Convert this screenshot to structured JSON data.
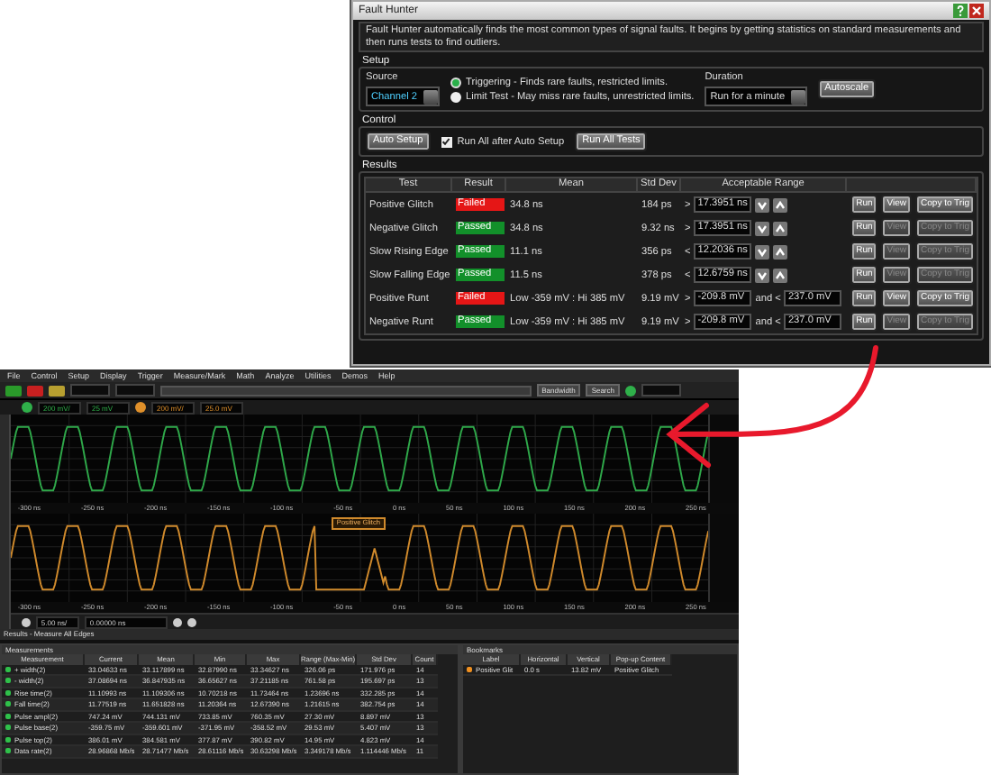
{
  "dialog": {
    "title": "Fault Hunter",
    "description": "Fault Hunter automatically finds the most common types of signal faults. It begins by getting statistics on standard measurements and then runs tests to find outliers.",
    "setup": {
      "title": "Setup",
      "source_label": "Source",
      "source": "Channel 2",
      "modes": [
        {
          "label": "Triggering - Finds rare faults, restricted limits.",
          "selected": true
        },
        {
          "label": "Limit Test - May miss rare faults, unrestricted limits.",
          "selected": false
        }
      ],
      "duration_label": "Duration",
      "duration": "Run for a minute",
      "autoscale": "Autoscale"
    },
    "control": {
      "title": "Control",
      "auto_setup": "Auto Setup",
      "run_all_after": {
        "label": "Run All after Auto Setup",
        "checked": true
      },
      "run_all": "Run All Tests"
    },
    "results": {
      "title": "Results",
      "columns": [
        "Test",
        "Result",
        "Mean",
        "Std Dev",
        "Acceptable Range"
      ],
      "rows": [
        {
          "test": "Positive Glitch",
          "result": "Failed",
          "passed": false,
          "mean": "34.8 ns",
          "std_dev": "184 ps",
          "kind": "threshold",
          "op": ">",
          "limit": "17.3951 ns",
          "run": "Run",
          "view": {
            "label": "View",
            "disabled": false
          },
          "copy": {
            "label": "Copy to Trig",
            "disabled": false
          }
        },
        {
          "test": "Negative Glitch",
          "result": "Passed",
          "passed": true,
          "mean": "34.8 ns",
          "std_dev": "9.32 ns",
          "kind": "threshold",
          "op": ">",
          "limit": "17.3951 ns",
          "run": "Run",
          "view": {
            "label": "View",
            "disabled": true
          },
          "copy": {
            "label": "Copy to Trig",
            "disabled": true
          }
        },
        {
          "test": "Slow Rising Edge",
          "result": "Passed",
          "passed": true,
          "mean": "11.1 ns",
          "std_dev": "356 ps",
          "kind": "threshold",
          "op": "<",
          "limit": "12.2036 ns",
          "run": "Run",
          "view": {
            "label": "View",
            "disabled": true
          },
          "copy": {
            "label": "Copy to Trig",
            "disabled": true
          }
        },
        {
          "test": "Slow Falling Edge",
          "result": "Passed",
          "passed": true,
          "mean": "11.5 ns",
          "std_dev": "378 ps",
          "kind": "threshold",
          "op": "<",
          "limit": "12.6759 ns",
          "run": "Run",
          "view": {
            "label": "View",
            "disabled": true
          },
          "copy": {
            "label": "Copy to Trig",
            "disabled": true
          }
        },
        {
          "test": "Positive Runt",
          "result": "Failed",
          "passed": false,
          "mean": "Low -359 mV : Hi 385 mV",
          "std_dev": "9.19 mV",
          "kind": "window",
          "op": ">",
          "limit": "-209.8 mV",
          "joiner": "and <",
          "limit2": "237.0 mV",
          "run": "Run",
          "view": {
            "label": "View",
            "disabled": false
          },
          "copy": {
            "label": "Copy to Trig",
            "disabled": false
          }
        },
        {
          "test": "Negative Runt",
          "result": "Passed",
          "passed": true,
          "mean": "Low -359 mV : Hi 385 mV",
          "std_dev": "9.19 mV",
          "kind": "window",
          "op": ">",
          "limit": "-209.8 mV",
          "joiner": "and <",
          "limit2": "237.0 mV",
          "run": "Run",
          "view": {
            "label": "View",
            "disabled": true
          },
          "copy": {
            "label": "Copy to Trig",
            "disabled": true
          }
        }
      ]
    }
  },
  "scope": {
    "menu": [
      "File",
      "Control",
      "Setup",
      "Display",
      "Trigger",
      "Measure/Mark",
      "Math",
      "Analyze",
      "Utilities",
      "Demos",
      "Help"
    ],
    "toolbar": {
      "bandwidth": "Bandwidth",
      "search": "Search"
    },
    "channels": [
      {
        "scale": "200 mV/",
        "offset": "25 mV",
        "color": "#2fb04a"
      },
      {
        "scale": "200 mV/",
        "offset": "25.0 mV",
        "color": "#e0902a"
      }
    ],
    "traces": [
      {
        "color": "#2fa84a",
        "glitch": false,
        "xticks": [
          "-300 ns",
          "-250 ns",
          "-200 ns",
          "-150 ns",
          "-100 ns",
          "-50 ns",
          "0 ns",
          "50 ns",
          "100 ns",
          "150 ns",
          "200 ns",
          "250 ns"
        ]
      },
      {
        "color": "#d08a2c",
        "glitch": true,
        "popup": "Positive Glitch",
        "xticks": [
          "-300 ns",
          "-250 ns",
          "-200 ns",
          "-150 ns",
          "-100 ns",
          "-50 ns",
          "0 ns",
          "50 ns",
          "100 ns",
          "150 ns",
          "200 ns",
          "250 ns"
        ]
      }
    ],
    "timebase": {
      "scale": "5.00 ns/",
      "delay": "0.00000 ns"
    },
    "results_panel": {
      "title": "Results - Measure All Edges",
      "measurements": {
        "title": "Measurements",
        "columns": [
          "Measurement",
          "Current",
          "Mean",
          "Min",
          "Max",
          "Range (Max-Min)",
          "Std Dev",
          "Count"
        ],
        "rows": [
          {
            "color": "#2fc04a",
            "cells": [
              "+ width(2)",
              "33.04633 ns",
              "33.117899 ns",
              "32.87990 ns",
              "33.34627 ns",
              "326.06 ps",
              "171.976 ps",
              "14"
            ]
          },
          {
            "color": "#2fc04a",
            "cells": [
              "- width(2)",
              "37.08694 ns",
              "36.847935 ns",
              "36.65627 ns",
              "37.21185 ns",
              "761.58 ps",
              "195.697 ps",
              "13"
            ]
          },
          {
            "color": "#2fc04a",
            "cells": [
              "Rise time(2)",
              "11.10993 ns",
              "11.109306 ns",
              "10.70218 ns",
              "11.73464 ns",
              "1.23696 ns",
              "332.285 ps",
              "14"
            ]
          },
          {
            "color": "#2fc04a",
            "cells": [
              "Fall time(2)",
              "11.77519 ns",
              "11.651828 ns",
              "11.20364 ns",
              "12.67390 ns",
              "1.21615 ns",
              "382.754 ps",
              "14"
            ]
          },
          {
            "color": "#2fc04a",
            "cells": [
              "Pulse ampl(2)",
              "747.24 mV",
              "744.131 mV",
              "733.85 mV",
              "760.35 mV",
              "27.30 mV",
              "8.897 mV",
              "13"
            ]
          },
          {
            "color": "#2fc04a",
            "cells": [
              "Pulse base(2)",
              "-359.75 mV",
              "-359.601 mV",
              "-371.95 mV",
              "-358.52 mV",
              "29.53 mV",
              "5.407 mV",
              "13"
            ]
          },
          {
            "color": "#2fc04a",
            "cells": [
              "Pulse top(2)",
              "386.01 mV",
              "384.581 mV",
              "377.87 mV",
              "390.82 mV",
              "14.95 mV",
              "4.823 mV",
              "14"
            ]
          },
          {
            "color": "#2fc04a",
            "cells": [
              "Data rate(2)",
              "28.96868 Mb/s",
              "28.71477 Mb/s",
              "28.61116 Mb/s",
              "30.63298 Mb/s",
              "3.349178 Mb/s",
              "1.114446 Mb/s",
              "11"
            ]
          }
        ]
      },
      "bookmarks": {
        "title": "Bookmarks",
        "columns": [
          "Label",
          "Horizontal",
          "Vertical",
          "Pop-up Content"
        ],
        "rows": [
          {
            "color": "#f09020",
            "cells": [
              "Positive Glit",
              "0.0 s",
              "13.82 mV",
              "Positive Glitch"
            ]
          }
        ]
      }
    }
  }
}
